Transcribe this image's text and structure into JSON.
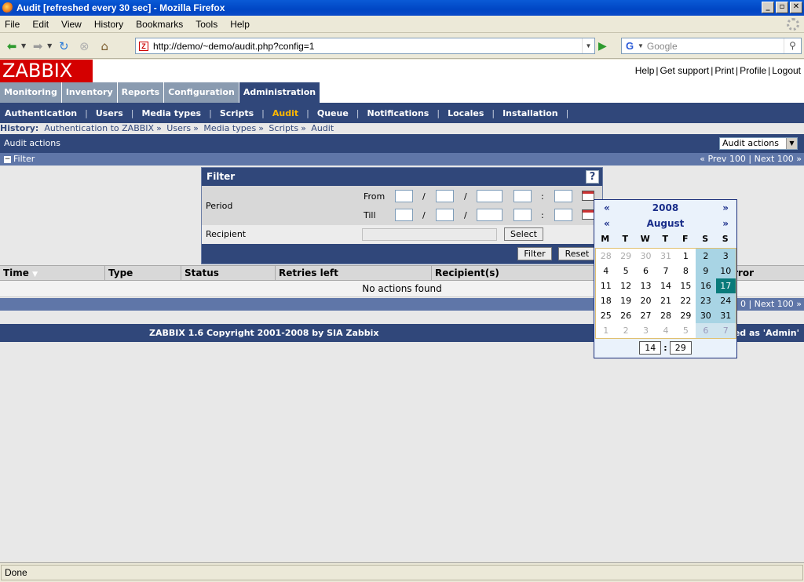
{
  "window": {
    "title": "Audit [refreshed every 30 sec] - Mozilla Firefox"
  },
  "menu": [
    "File",
    "Edit",
    "View",
    "History",
    "Bookmarks",
    "Tools",
    "Help"
  ],
  "address": {
    "url": "http://demo/~demo/audit.php?config=1"
  },
  "search": {
    "placeholder": "Google"
  },
  "zabbix": {
    "logo": "ZABBIX",
    "top_links": [
      "Help",
      "Get support",
      "Print",
      "Profile",
      "Logout"
    ],
    "main_tabs": [
      {
        "label": "Monitoring",
        "active": false
      },
      {
        "label": "Inventory",
        "active": false
      },
      {
        "label": "Reports",
        "active": false
      },
      {
        "label": "Configuration",
        "active": false
      },
      {
        "label": "Administration",
        "active": true
      }
    ],
    "sub_tabs": [
      {
        "label": "Authentication",
        "active": false
      },
      {
        "label": "Users",
        "active": false
      },
      {
        "label": "Media types",
        "active": false
      },
      {
        "label": "Scripts",
        "active": false
      },
      {
        "label": "Audit",
        "active": true
      },
      {
        "label": "Queue",
        "active": false
      },
      {
        "label": "Notifications",
        "active": false
      },
      {
        "label": "Locales",
        "active": false
      },
      {
        "label": "Installation",
        "active": false
      }
    ],
    "history": {
      "label": "History:",
      "items": [
        "Authentication to ZABBIX",
        "Users",
        "Media types",
        "Scripts",
        "Audit"
      ]
    },
    "page_title": "Audit actions",
    "view_select": "Audit actions",
    "filter_toggle": "Filter",
    "pager": {
      "prev": "« Prev 100",
      "next": "Next 100 »"
    },
    "pager_bottom": "0 | Next 100 »",
    "filter_panel": {
      "title": "Filter",
      "help": "?",
      "period_label": "Period",
      "from_label": "From",
      "till_label": "Till",
      "recipient_label": "Recipient",
      "select_button": "Select",
      "filter_button": "Filter",
      "reset_button": "Reset"
    },
    "table": {
      "columns": [
        "Time",
        "Type",
        "Status",
        "Retries left",
        "Recipient(s)",
        "rror"
      ],
      "empty_message": "No actions found"
    },
    "footer": {
      "copyright": "ZABBIX 1.6 Copyright 2001-2008 by  SIA Zabbix",
      "connected": "ted as 'Admin'"
    },
    "calendar": {
      "year": "2008",
      "month": "August",
      "prev": "«",
      "next": "»",
      "days_of_week": [
        "M",
        "T",
        "W",
        "T",
        "F",
        "S",
        "S"
      ],
      "weeks": [
        [
          "28",
          "29",
          "30",
          "31",
          "1",
          "2",
          "3"
        ],
        [
          "4",
          "5",
          "6",
          "7",
          "8",
          "9",
          "10"
        ],
        [
          "11",
          "12",
          "13",
          "14",
          "15",
          "16",
          "17"
        ],
        [
          "18",
          "19",
          "20",
          "21",
          "22",
          "23",
          "24"
        ],
        [
          "25",
          "26",
          "27",
          "28",
          "29",
          "30",
          "31"
        ],
        [
          "1",
          "2",
          "3",
          "4",
          "5",
          "6",
          "7"
        ]
      ],
      "other_month_cells": [
        "0-0",
        "0-1",
        "0-2",
        "0-3",
        "5-0",
        "5-1",
        "5-2",
        "5-3",
        "5-4",
        "5-5",
        "5-6"
      ],
      "selected_cell": "2-6",
      "hour": "14",
      "minute": "29"
    }
  },
  "status_bar": "Done"
}
